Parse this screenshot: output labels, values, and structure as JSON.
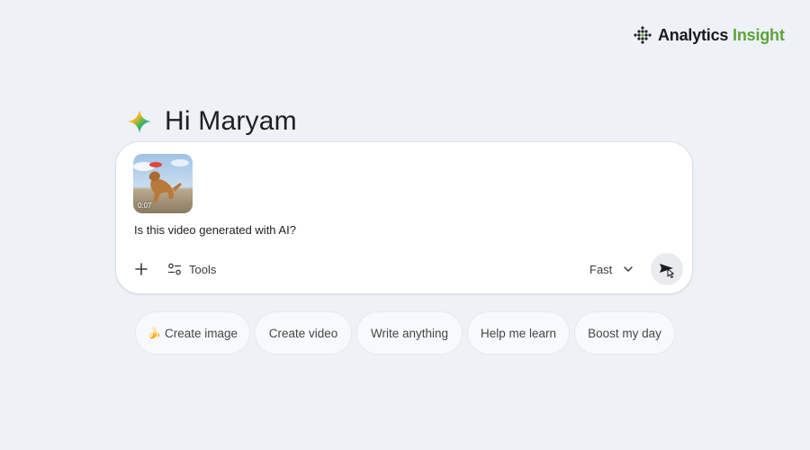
{
  "watermark": {
    "brand_part1": "Analytics",
    "brand_part2": "Insight",
    "icon": "dotted-logo-icon"
  },
  "greeting": {
    "text": "Hi Maryam",
    "icon": "gemini-sparkle-icon"
  },
  "prompt_card": {
    "attachment": {
      "type": "video-thumbnail",
      "duration": "0:07"
    },
    "prompt_text": "Is this video generated with AI?",
    "add_icon": "plus-icon",
    "tools_label": "Tools",
    "tools_icon": "sliders-icon",
    "model_label": "Fast",
    "model_icon": "chevron-down-icon",
    "send_icon": "send-icon"
  },
  "suggestions": [
    {
      "label": "Create image",
      "icon": "banana-icon",
      "icon_glyph": "🍌"
    },
    {
      "label": "Create video"
    },
    {
      "label": "Write anything"
    },
    {
      "label": "Help me learn"
    },
    {
      "label": "Boost my day"
    }
  ],
  "colors": {
    "background": "#eef1f6",
    "card": "#ffffff",
    "chip": "#f8f9fb",
    "brand_green": "#5ca43a"
  }
}
